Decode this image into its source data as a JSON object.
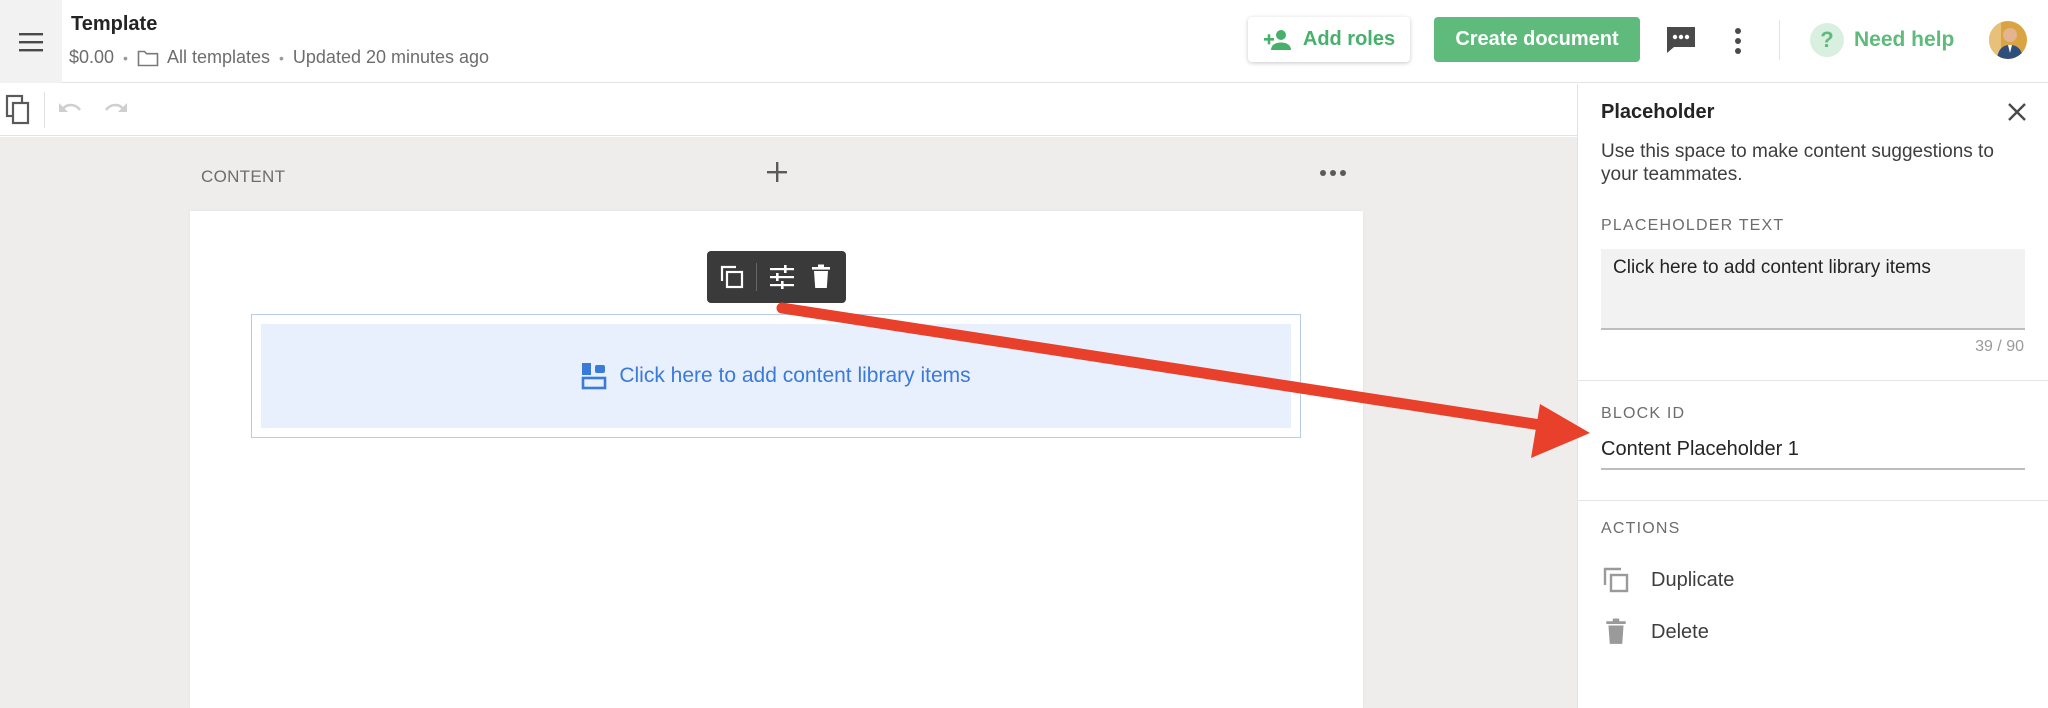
{
  "header": {
    "title": "Template",
    "price": "$0.00",
    "folder": "All templates",
    "updated": "Updated 20 minutes ago",
    "add_roles_label": "Add roles",
    "create_document_label": "Create document",
    "need_help_label": "Need help",
    "help_glyph": "?"
  },
  "canvas": {
    "section_label": "CONTENT",
    "placeholder_text": "Click here to add content library items"
  },
  "panel": {
    "title": "Placeholder",
    "description": "Use this space to make content suggestions to your teammates.",
    "placeholder_text_label": "PLACEHOLDER TEXT",
    "placeholder_text_value": "Click here to add content library items",
    "char_count": "39 / 90",
    "block_id_label": "BLOCK ID",
    "block_id_value": "Content Placeholder 1",
    "actions_label": "ACTIONS",
    "actions": [
      {
        "label": "Duplicate",
        "icon": "duplicate-icon"
      },
      {
        "label": "Delete",
        "icon": "trash-icon"
      }
    ]
  },
  "colors": {
    "brand_green": "#5fbb7b",
    "link_blue": "#3a7ad9",
    "arrow_red": "#e8402a",
    "canvas_bg": "#eeedeb"
  }
}
